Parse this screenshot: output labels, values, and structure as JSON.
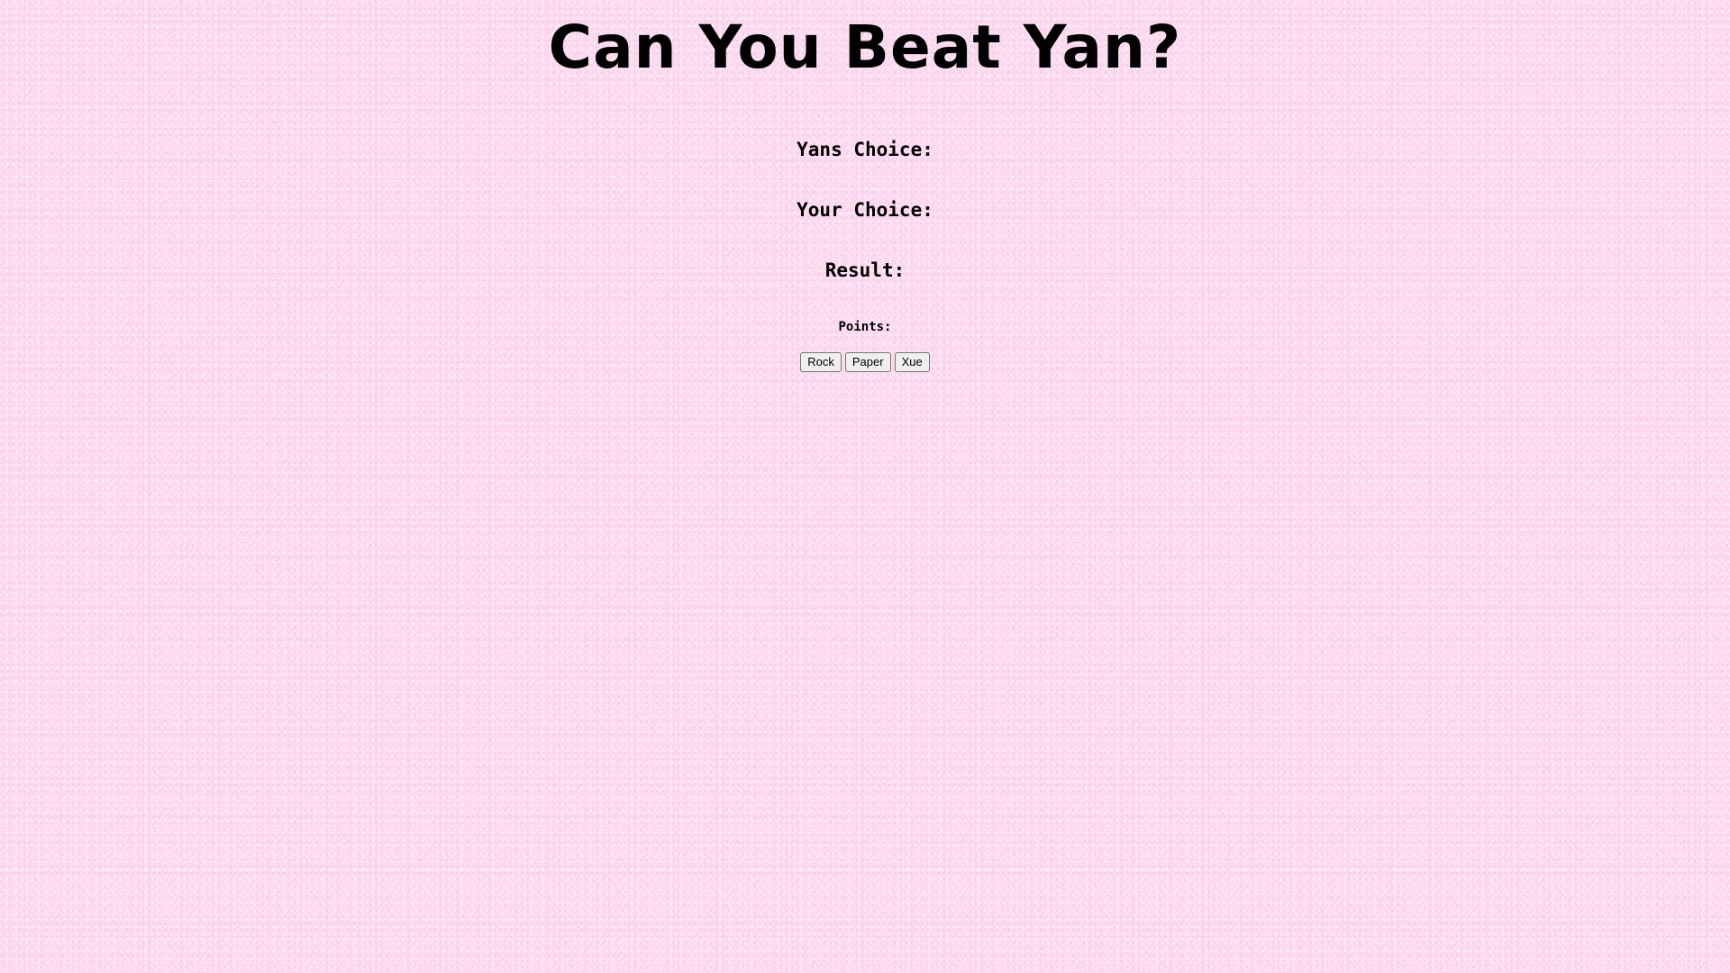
{
  "title": "Can You Beat Yan?",
  "labels": {
    "yans_choice": "Yans Choice:",
    "your_choice": "Your Choice:",
    "result": "Result:",
    "points": "Points:"
  },
  "buttons": {
    "rock": "Rock",
    "paper": "Paper",
    "xue": "Xue"
  },
  "colors": {
    "background": "#fcd9ef",
    "text": "#000000"
  }
}
